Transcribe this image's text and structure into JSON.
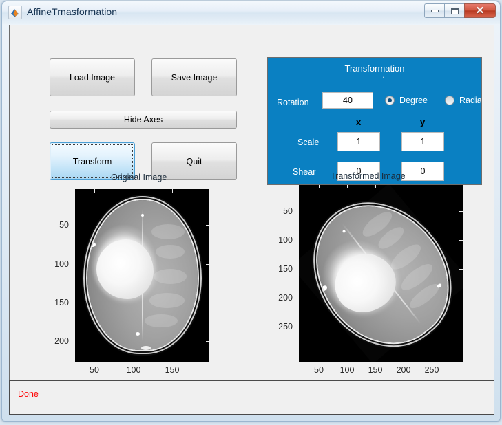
{
  "window": {
    "title": "AffineTrnasformation",
    "app_icon": "matlab-membrane-icon",
    "minimize_label": "Minimize",
    "maximize_label": "Maximize",
    "close_label": "✕"
  },
  "buttons": {
    "load_image": "Load Image",
    "save_image": "Save Image",
    "hide_axes": "Hide Axes",
    "transform": "Transform",
    "quit": "Quit"
  },
  "params": {
    "panel_title_line1": "Transformation",
    "panel_title_line2": "parameters",
    "rotation_label": "Rotation",
    "rotation_value": "40",
    "degree_label": "Degree",
    "radian_label": "Radian",
    "angle_unit_selected": "Degree",
    "col_x": "x",
    "col_y": "y",
    "scale_label": "Scale",
    "scale_x": "1",
    "scale_y": "1",
    "shear_label": "Shear",
    "shear_x": "0",
    "shear_y": "0",
    "panel_color": "#0a80c2"
  },
  "plots": {
    "original": {
      "title": "Original Image",
      "y_ticks": [
        "50",
        "100",
        "150",
        "200"
      ],
      "x_ticks": [
        "50",
        "100",
        "150"
      ]
    },
    "transformed": {
      "title": "Transformed Image",
      "y_ticks": [
        "50",
        "100",
        "150",
        "200",
        "250"
      ],
      "x_ticks": [
        "50",
        "100",
        "150",
        "200",
        "250"
      ]
    }
  },
  "status": {
    "message": "Done",
    "color": "#ff0000"
  }
}
